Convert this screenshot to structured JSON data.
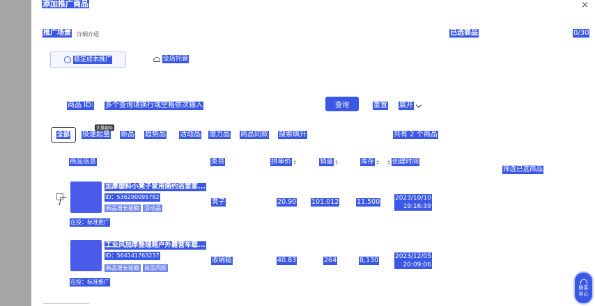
{
  "header": {
    "title": "添加推广商品",
    "close_symbol": "×"
  },
  "scene": {
    "label": "推广场景",
    "intro": "详细介绍"
  },
  "selected": {
    "label": "已选商品",
    "count": "0/30"
  },
  "modes": [
    {
      "label": "稳定成本推广",
      "icon": "coin-icon",
      "active": true
    },
    {
      "label": "全店托管",
      "icon": "cloud-icon",
      "active": false
    }
  ],
  "search": {
    "id_label": "商品 ID:",
    "placeholder": "多个查询请换行或空格依次输入",
    "query_label": "查询",
    "reset_label": "重置",
    "expand_label": "展开"
  },
  "tabs": [
    "全部",
    "极速起量",
    "新品",
    "趋势品",
    "活动品",
    "潜力品",
    "商品同款",
    "搜索飙升"
  ],
  "tab_tooltip": "流量翻倍",
  "total": {
    "prefix": "共有",
    "num": "2",
    "suffix": "个商品"
  },
  "table": {
    "columns": [
      "商品信息",
      "类目",
      "拼单价",
      "销量",
      "库存",
      "创建时间"
    ],
    "filter_selected_label": "筛选已选商品",
    "rows": [
      {
        "name": "加厚塑料小凳子家用简约浴室客...",
        "id": "ID：536290095782",
        "tags": [
          "新品增长秘籍",
          "活动品"
        ],
        "promo": "在投：标准推广",
        "category": "凳子",
        "price": "20.90",
        "sales": "101,012",
        "stock": "11,500",
        "date": "2023/10/10",
        "time": "19:16:39"
      },
      {
        "name": "工业风加厚整理箱户外露营车载...",
        "id": "ID：564141763237",
        "tags": [
          "新品增长秘籍",
          "商品同款"
        ],
        "promo": "在投：标准推广",
        "category": "收纳箱",
        "price": "40.83",
        "sales": "264",
        "stock": "8,130",
        "date": "2023/12/05",
        "time": "20:09:06"
      }
    ]
  },
  "service": {
    "line1": "联系",
    "line2": "中心"
  },
  "colors": {
    "accent": "#3b57e6",
    "thumb": "#4a5bea",
    "side_strip": "#a6a6a6"
  }
}
